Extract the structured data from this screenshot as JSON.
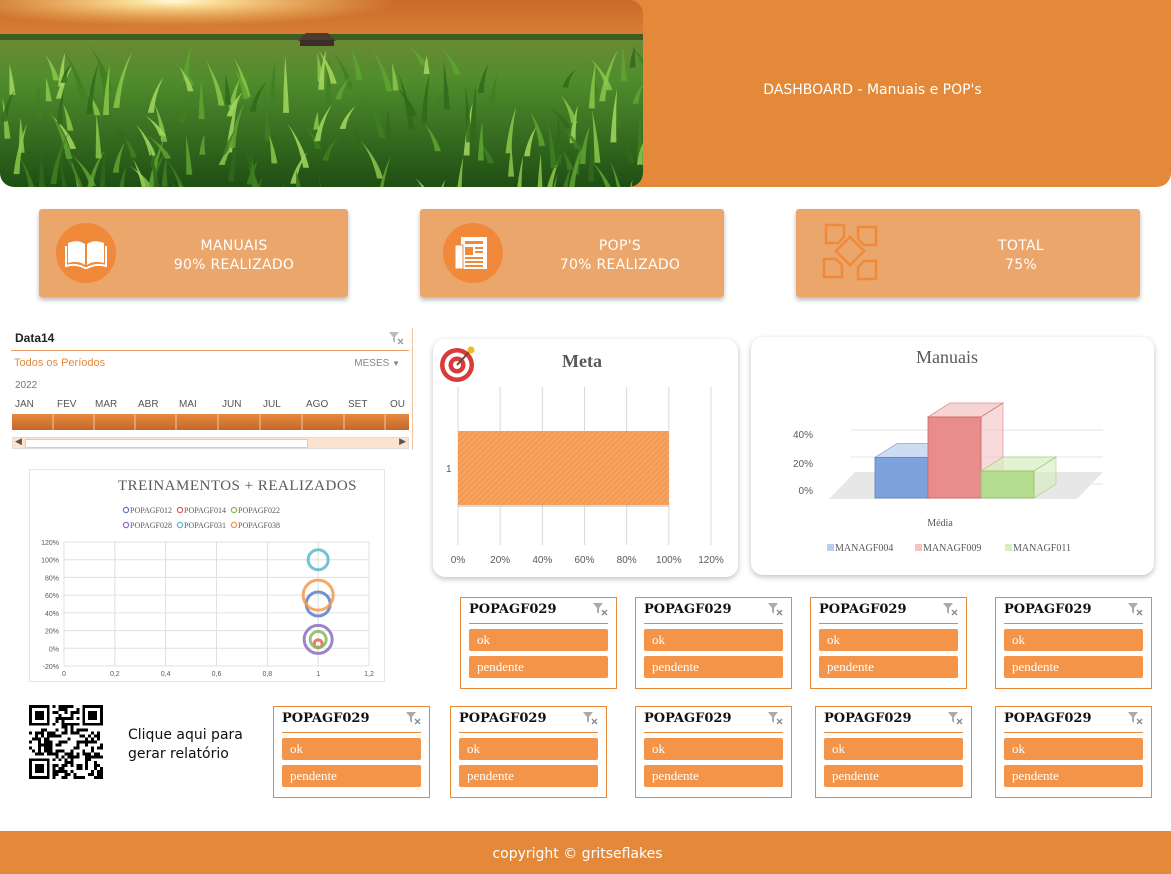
{
  "header": {
    "title": "DASHBOARD - Manuais e POP's"
  },
  "kpis": [
    {
      "line1": "MANUAIS",
      "line2": "90% REALIZADO",
      "icon": "open-book-icon"
    },
    {
      "line1": "POP'S",
      "line2": "70% REALIZADO",
      "icon": "newspaper-icon"
    },
    {
      "line1": "TOTAL",
      "line2": "75%",
      "icon": "hands-teamwork-icon"
    }
  ],
  "timeline": {
    "title": "Data14",
    "period": "Todos os Períodos",
    "unit": "MESES",
    "year": "2022",
    "months": [
      "JAN",
      "FEV",
      "MAR",
      "ABR",
      "MAI",
      "JUN",
      "JUL",
      "AGO",
      "SET",
      "OU"
    ]
  },
  "colors": {
    "accent": "#e4893a",
    "card": "#eba66b",
    "slicer_item": "#f39449"
  },
  "bubble_chart": {
    "title": "TREINAMENTOS + REALIZADOS",
    "legend": [
      "POPAGF012",
      "POPAGF014",
      "POPAGF022",
      "POPAGF028",
      "POPAGF031",
      "POPAGF038"
    ],
    "colors": [
      "#5b7ec8",
      "#e0625a",
      "#8ab95a",
      "#8a6fc0",
      "#5ab8d0",
      "#f39a4a"
    ],
    "y_ticks": [
      "120%",
      "100%",
      "80%",
      "60%",
      "40%",
      "20%",
      "0%",
      "-20%"
    ],
    "x_ticks": [
      "0",
      "0,2",
      "0,4",
      "0,6",
      "0,8",
      "1",
      "1,2"
    ]
  },
  "meta_chart": {
    "title": "Meta",
    "category": "1",
    "x_ticks": [
      "0%",
      "20%",
      "40%",
      "60%",
      "80%",
      "100%",
      "120%"
    ]
  },
  "manuais_chart": {
    "title": "Manuais",
    "y_ticks": [
      "40%",
      "20%",
      "0%"
    ],
    "category": "Média",
    "legend": [
      "MANAGF004",
      "MANAGF009",
      "MANAGF011"
    ]
  },
  "slicers": [
    {
      "title": "POPAGF029",
      "items": [
        "ok",
        "pendente"
      ]
    },
    {
      "title": "POPAGF029",
      "items": [
        "ok",
        "pendente"
      ]
    },
    {
      "title": "POPAGF029",
      "items": [
        "ok",
        "pendente"
      ]
    },
    {
      "title": "POPAGF029",
      "items": [
        "ok",
        "pendente"
      ]
    },
    {
      "title": "POPAGF029",
      "items": [
        "ok",
        "pendente"
      ]
    },
    {
      "title": "POPAGF029",
      "items": [
        "ok",
        "pendente"
      ]
    },
    {
      "title": "POPAGF029",
      "items": [
        "ok",
        "pendente"
      ]
    },
    {
      "title": "POPAGF029",
      "items": [
        "ok",
        "pendente"
      ]
    },
    {
      "title": "POPAGF029",
      "items": [
        "ok",
        "pendente"
      ]
    }
  ],
  "report": {
    "line1": "Clique aqui para",
    "line2": "gerar relatório"
  },
  "footer": {
    "copyright": "copyright © gritseflakes"
  },
  "chart_data": [
    {
      "type": "scatter",
      "title": "TREINAMENTOS + REALIZADOS",
      "xlim": [
        0,
        1.2
      ],
      "ylim": [
        -0.2,
        1.2
      ],
      "series": [
        {
          "name": "POPAGF012",
          "x": [
            1
          ],
          "y": [
            0.5
          ]
        },
        {
          "name": "POPAGF014",
          "x": [
            1
          ],
          "y": [
            0.05
          ]
        },
        {
          "name": "POPAGF022",
          "x": [
            1
          ],
          "y": [
            0.1
          ]
        },
        {
          "name": "POPAGF028",
          "x": [
            1
          ],
          "y": [
            0.1
          ]
        },
        {
          "name": "POPAGF031",
          "x": [
            1
          ],
          "y": [
            1.0
          ]
        },
        {
          "name": "POPAGF038",
          "x": [
            1
          ],
          "y": [
            0.6
          ]
        }
      ]
    },
    {
      "type": "bar",
      "title": "Meta",
      "categories": [
        "1"
      ],
      "values": [
        1.0
      ],
      "xlim": [
        0,
        1.2
      ]
    },
    {
      "type": "bar",
      "title": "Manuais",
      "categories": [
        "Média"
      ],
      "series": [
        {
          "name": "MANAGF004",
          "values": [
            0.3
          ]
        },
        {
          "name": "MANAGF009",
          "values": [
            0.6
          ]
        },
        {
          "name": "MANAGF011",
          "values": [
            0.2
          ]
        }
      ],
      "ylim": [
        0,
        0.4
      ]
    }
  ]
}
